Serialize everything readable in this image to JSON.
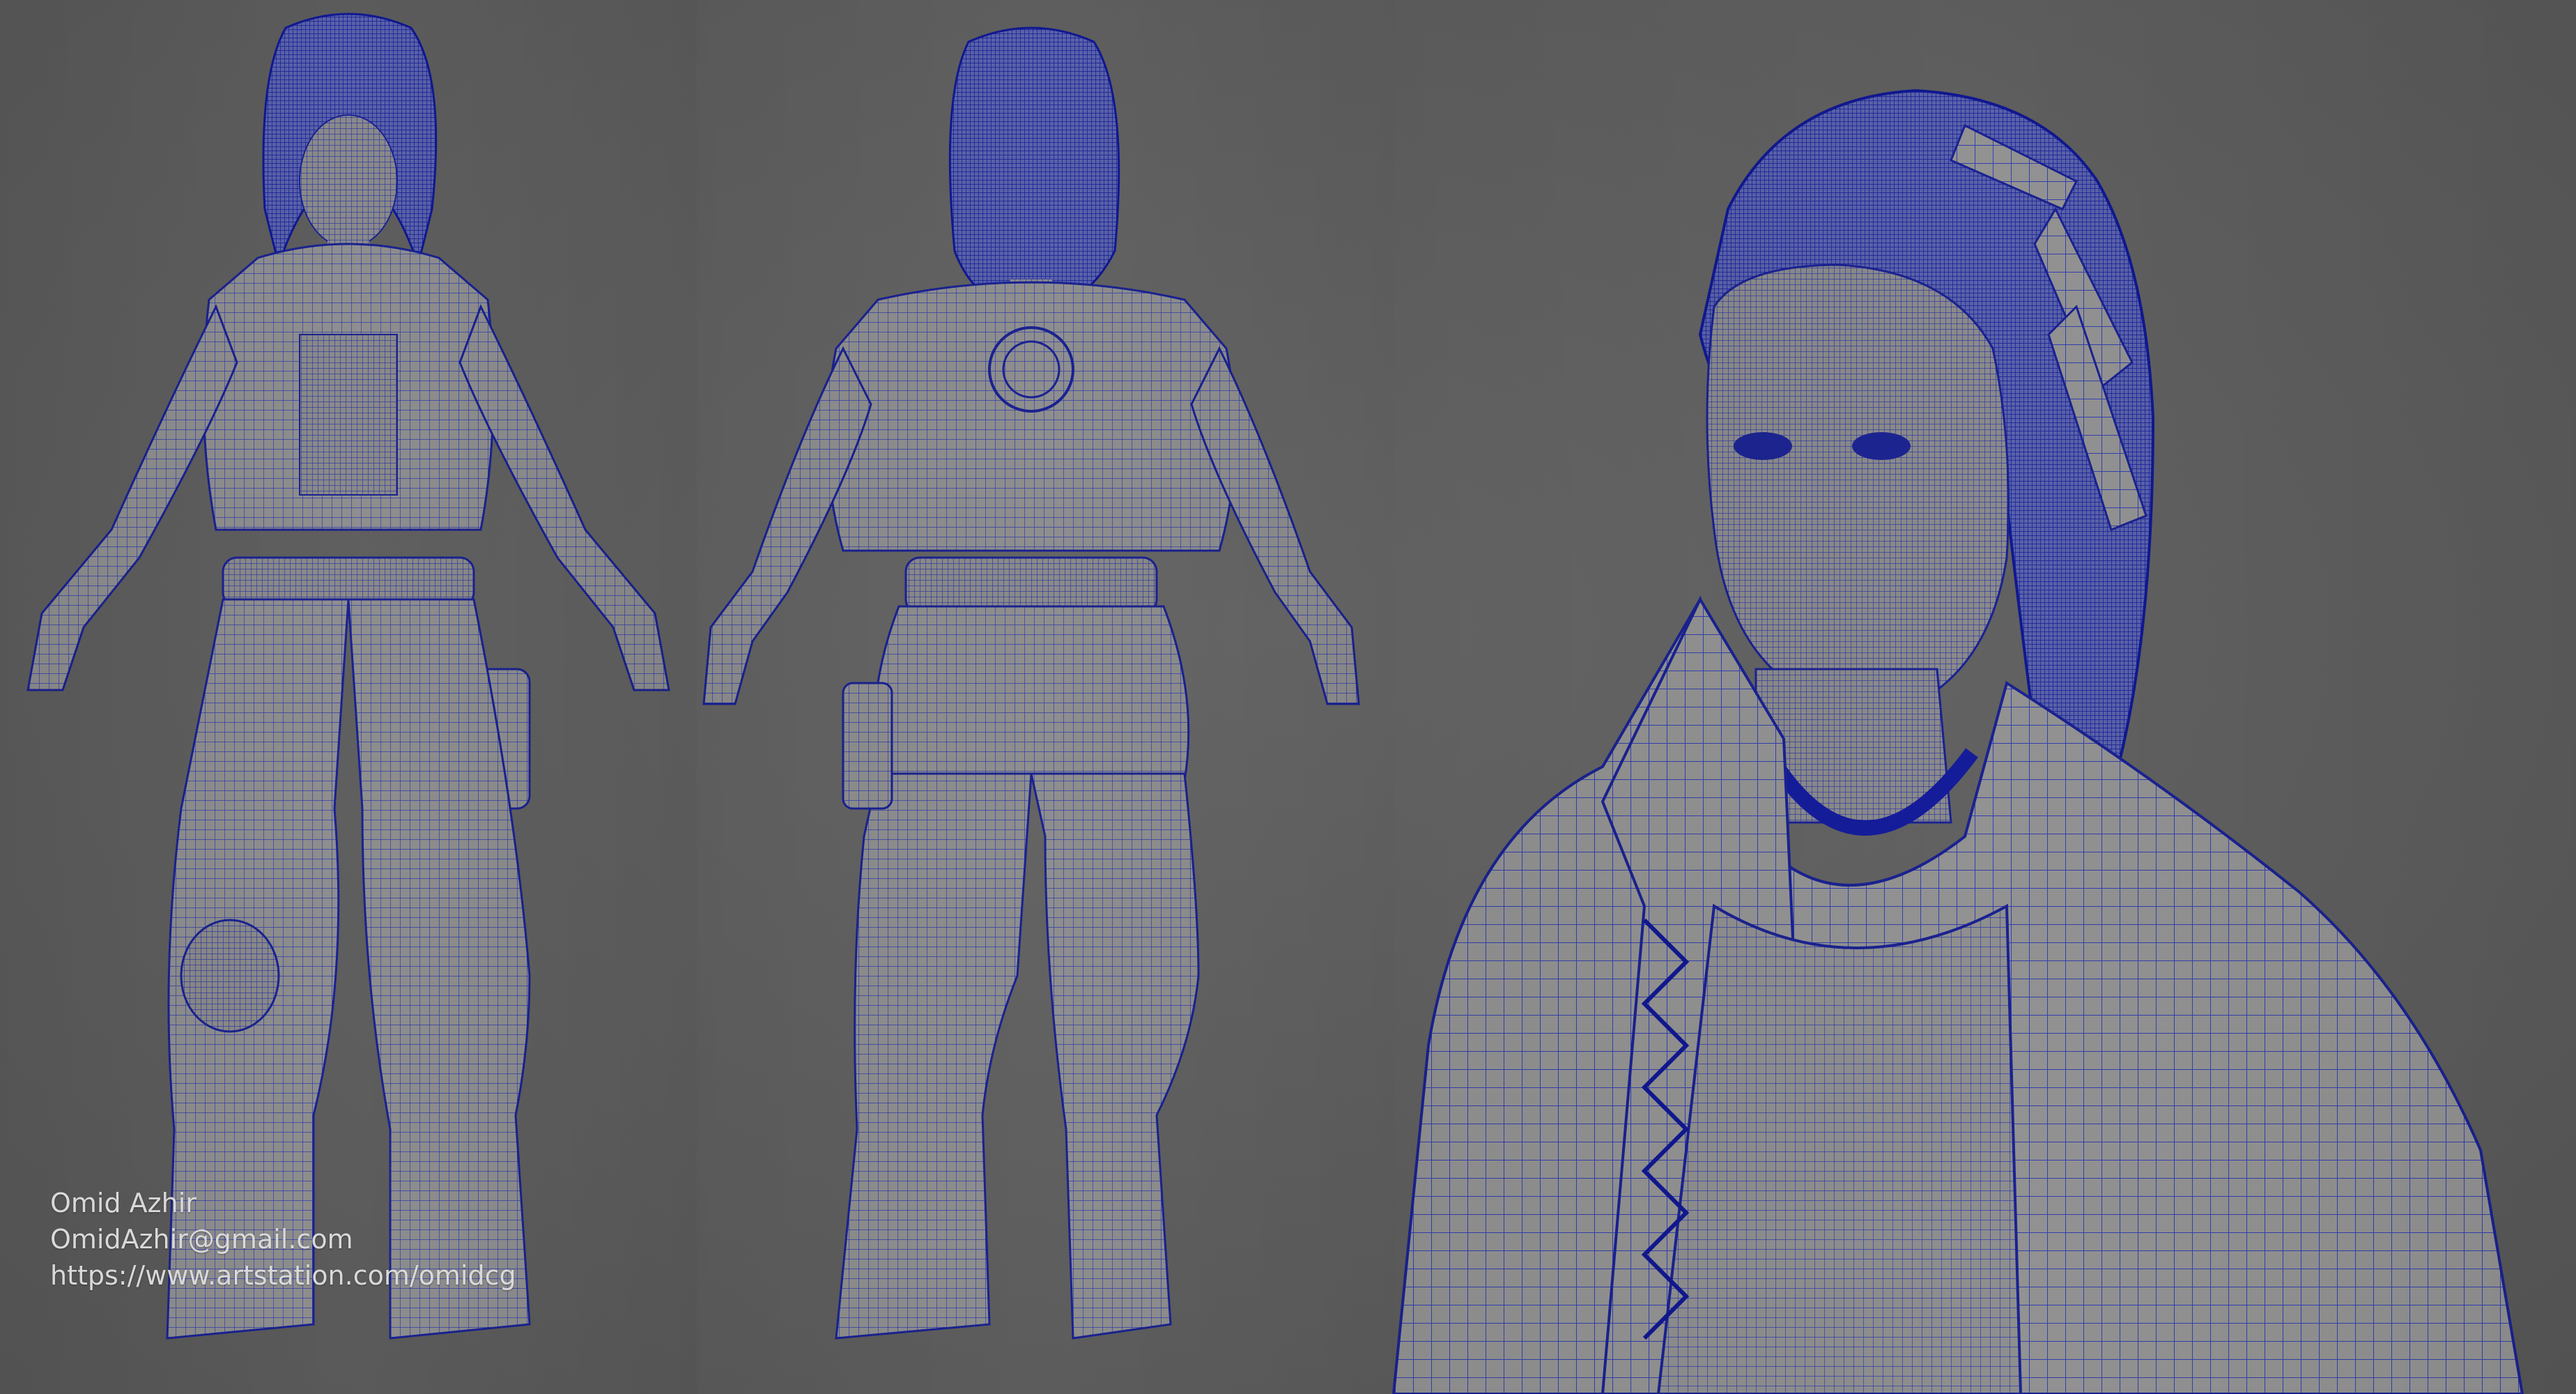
{
  "credits": {
    "name": "Omid Azhir",
    "email": "OmidAzhir@gmail.com",
    "url": "https://www.artstation.com/omidcg"
  },
  "colors": {
    "background": "#5f5f5f",
    "mesh_fill": "#8c8c8c",
    "wire": "#1f2aa8",
    "credit_text": "#d9d9d9"
  },
  "views": [
    {
      "name": "front-view",
      "subject": "full-body-front"
    },
    {
      "name": "back-view",
      "subject": "full-body-back"
    },
    {
      "name": "closeup-view",
      "subject": "head-and-torso"
    }
  ]
}
